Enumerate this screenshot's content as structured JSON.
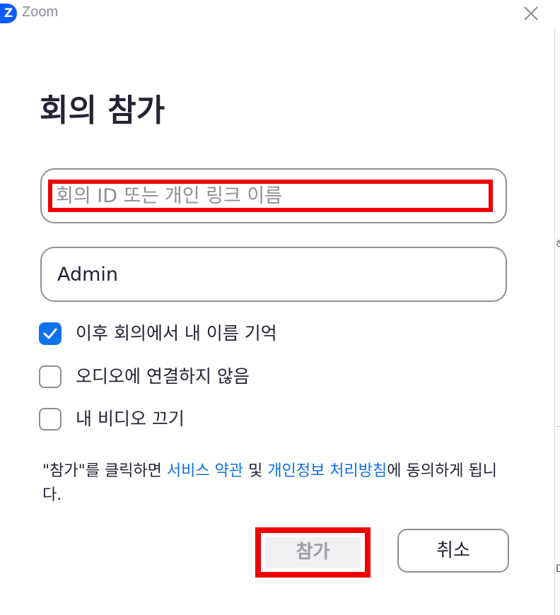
{
  "window": {
    "app_name": "Zoom",
    "logo_letter": "Z"
  },
  "page_title": "회의 참가",
  "meeting_input": {
    "placeholder": "회의 ID 또는 개인 링크 이름",
    "value": ""
  },
  "name_input": {
    "value": "Admin"
  },
  "options": [
    {
      "label": "이후 회의에서 내 이름 기억",
      "checked": true
    },
    {
      "label": "오디오에 연결하지 않음",
      "checked": false
    },
    {
      "label": "내 비디오 끄기",
      "checked": false
    }
  ],
  "terms": {
    "prefix": "\"참가\"를 클릭하면 ",
    "service_terms_link": "서비스 약관",
    "and": " 및 ",
    "privacy_link": "개인정보 처리방침",
    "suffix": "에 동의하게 됩니다."
  },
  "buttons": {
    "join": "참가",
    "cancel": "취소"
  },
  "background_fragments": {
    "right_char_1": "하",
    "right_char_2": "D"
  },
  "colors": {
    "accent": "#0e72ed",
    "highlight": "#ee0000",
    "brand": "#0b5cff"
  }
}
